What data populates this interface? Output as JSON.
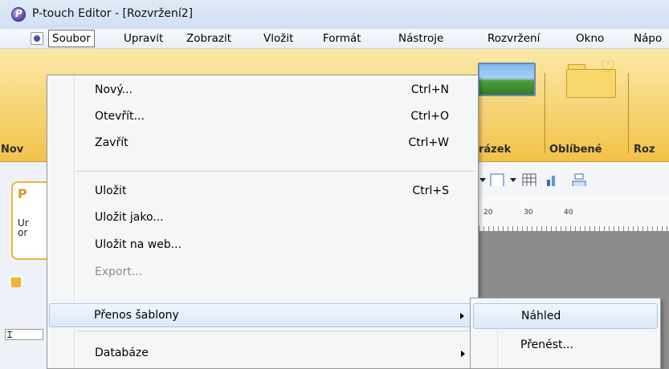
{
  "window": {
    "title": "P-touch Editor - [Rozvržení2]"
  },
  "menubar": {
    "items": [
      "Soubor",
      "Upravit",
      "Zobrazit",
      "Vložit",
      "Formát",
      "Nástroje",
      "Rozvržení",
      "Okno",
      "Nápo"
    ]
  },
  "ribbon": {
    "labels": [
      "Nov",
      "rázek",
      "Oblíbené",
      "Roz"
    ]
  },
  "leftpanel": {
    "header": "P",
    "text_line1": "Ur",
    "text_line2": "or"
  },
  "ruler": {
    "marks": [
      "20",
      "30",
      "40"
    ]
  },
  "file_menu": {
    "items": [
      {
        "label": "Nový...",
        "shortcut": "Ctrl+N"
      },
      {
        "label": "Otevřít...",
        "shortcut": "Ctrl+O"
      },
      {
        "label": "Zavřít",
        "shortcut": "Ctrl+W"
      },
      {
        "label": "Uložit",
        "shortcut": "Ctrl+S"
      },
      {
        "label": "Uložit jako...",
        "shortcut": ""
      },
      {
        "label": "Uložit na web...",
        "shortcut": ""
      },
      {
        "label": "Export...",
        "shortcut": ""
      },
      {
        "label": "Přenos šablony",
        "shortcut": ""
      },
      {
        "label": "Databáze",
        "shortcut": ""
      }
    ]
  },
  "transfer_submenu": {
    "items": [
      {
        "label": "Náhled"
      },
      {
        "label": "Přenést..."
      }
    ]
  },
  "colors": {
    "ribbon": "#f2c24a",
    "highlight_border": "#a8c8ec",
    "menu_bg": "#f5f6f7"
  }
}
